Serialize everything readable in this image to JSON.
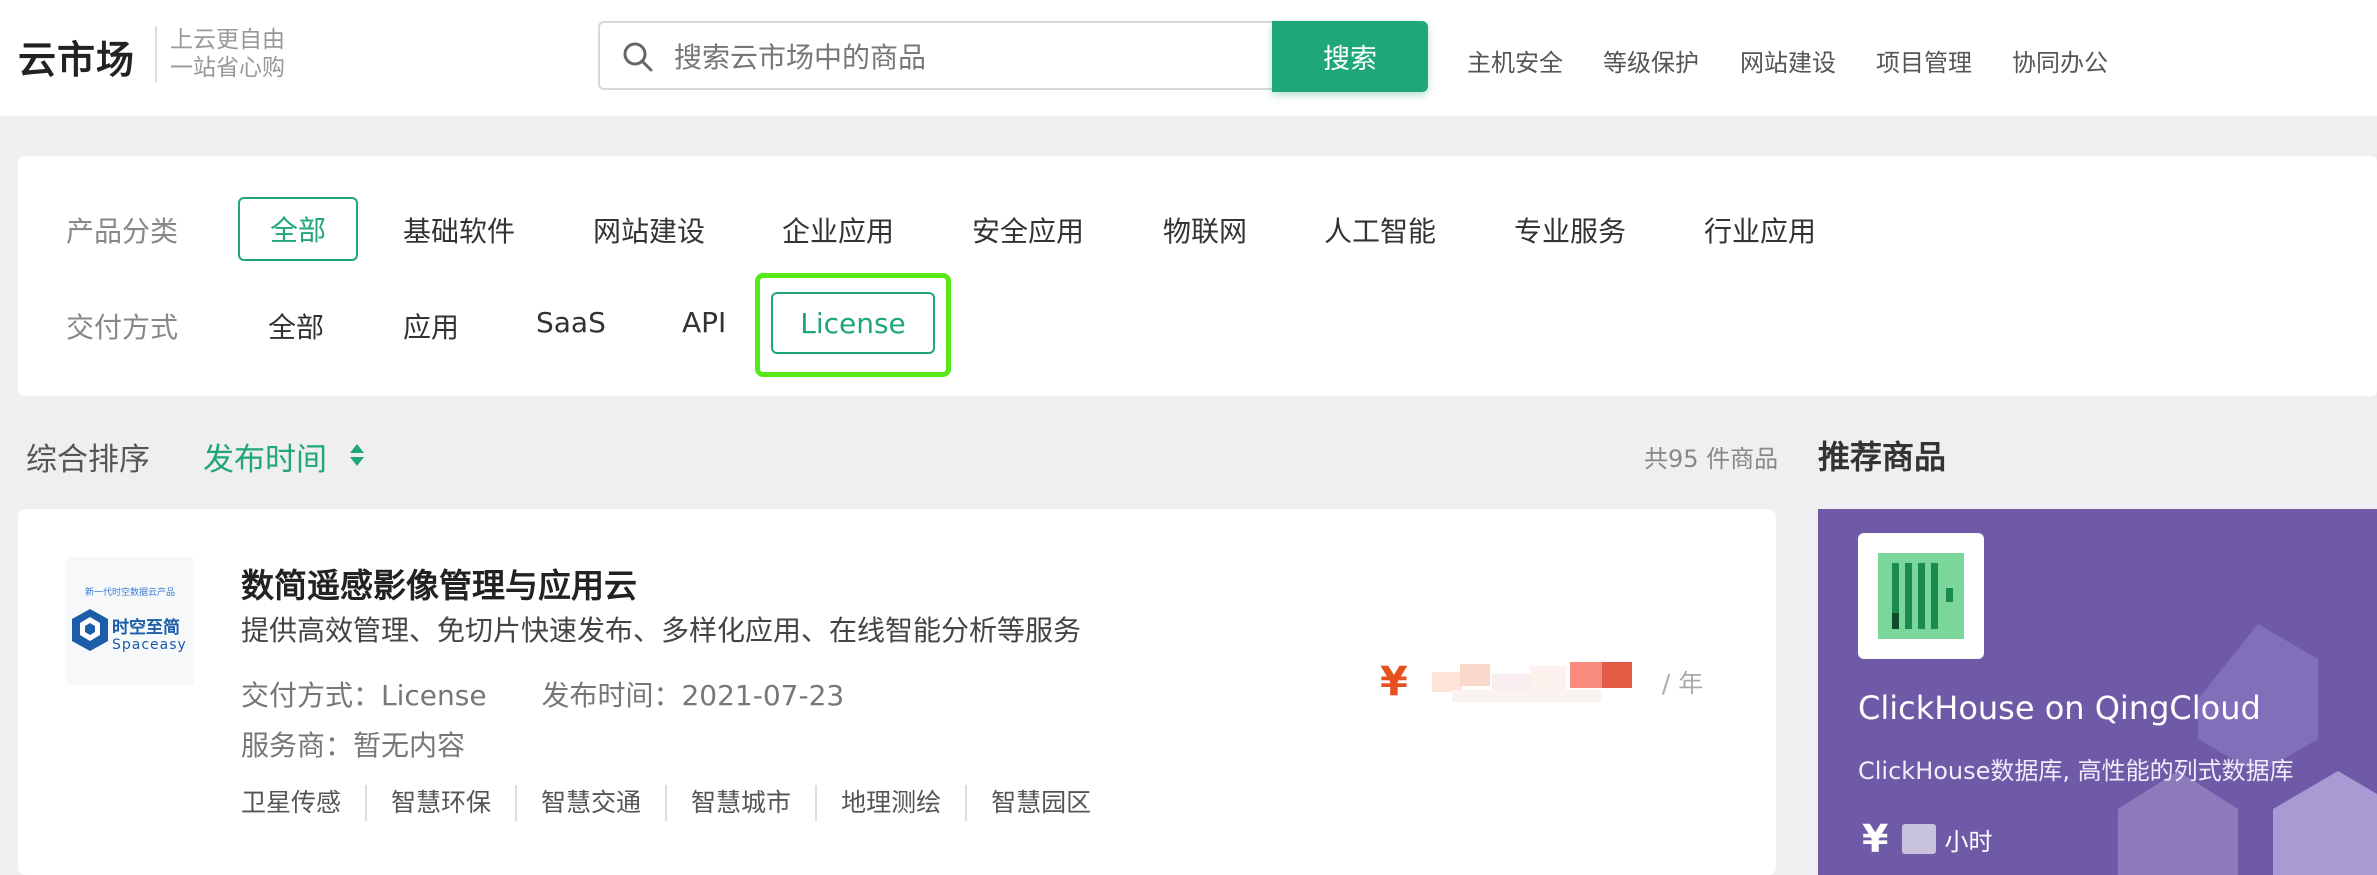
{
  "header": {
    "logo": "云市场",
    "slogan_line1": "上云更自由",
    "slogan_line2": "一站省心购",
    "search_placeholder": "搜索云市场中的商品",
    "search_button": "搜索",
    "nav": [
      "主机安全",
      "等级保护",
      "网站建设",
      "项目管理",
      "协同办公"
    ]
  },
  "filters": {
    "category_label": "产品分类",
    "categories": [
      "全部",
      "基础软件",
      "网站建设",
      "企业应用",
      "安全应用",
      "物联网",
      "人工智能",
      "专业服务",
      "行业应用"
    ],
    "category_selected": "全部",
    "delivery_label": "交付方式",
    "delivery": [
      "全部",
      "应用",
      "SaaS",
      "API",
      "License"
    ],
    "delivery_selected": "License"
  },
  "sort": {
    "default_label": "综合排序",
    "time_label": "发布时间",
    "total_text": "共95 件商品"
  },
  "product": {
    "logo_caption": "新一代时空数据云产品",
    "logo_brand_cn": "时空至简",
    "logo_brand_en": "Spaceasy",
    "title": "数简遥感影像管理与应用云",
    "description": "提供高效管理、免切片快速发布、多样化应用、在线智能分析等服务",
    "delivery_text": "交付方式：License",
    "release_text": "发布时间：2021-07-23",
    "vendor_text": "服务商：暂无内容",
    "tags": [
      "卫星传感",
      "智慧环保",
      "智慧交通",
      "智慧城市",
      "地理测绘",
      "智慧园区"
    ],
    "currency": "¥",
    "price_unit": "/ 年"
  },
  "recommend": {
    "title": "推荐商品",
    "name": "ClickHouse on QingCloud",
    "description": "ClickHouse数据库, 高性能的列式数据库",
    "currency": "¥",
    "price_unit": "小时"
  },
  "colors": {
    "brand_green": "#1fa67a",
    "highlight_outline": "#57e817",
    "price_orange": "#e8501f",
    "recommend_purple": "#6e5aa7"
  }
}
